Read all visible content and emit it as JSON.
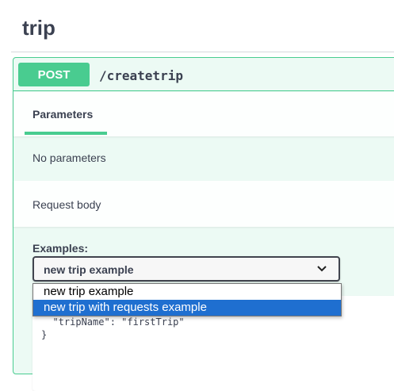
{
  "tag": {
    "title": "trip"
  },
  "operation": {
    "method": "POST",
    "path": "/createtrip"
  },
  "tabs": {
    "parameters_label": "Parameters"
  },
  "parameters": {
    "empty_text": "No parameters"
  },
  "request_body": {
    "title": "Request body"
  },
  "examples": {
    "label": "Examples:",
    "selected": "new trip example",
    "options": [
      "new trip example",
      "new trip with requests example"
    ],
    "highlighted_index": 1
  },
  "code": {
    "line_1": "  \"tripName\": \"firstTrip\"",
    "line_2": "}"
  },
  "colors": {
    "post_green": "#49cc90",
    "highlight_blue": "#1f6fd0"
  }
}
